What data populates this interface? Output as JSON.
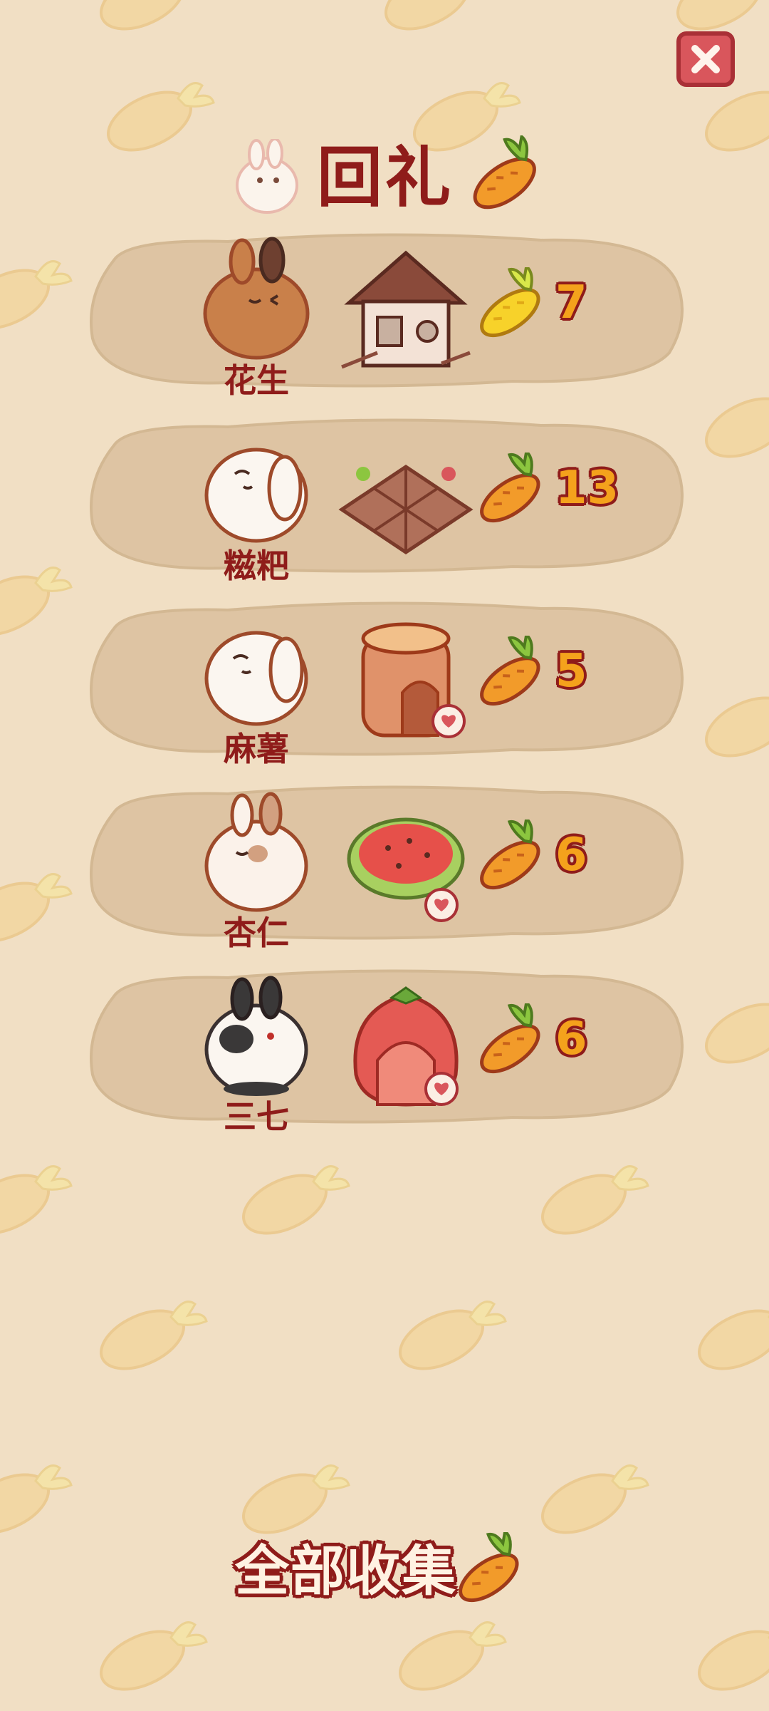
{
  "title": "回礼",
  "rewards": [
    {
      "name": "花生",
      "bunny_icon": "brown-bunny-icon",
      "item_icon": "wooden-house-icon",
      "reward_icon": "golden-carrot-icon",
      "count": "7"
    },
    {
      "name": "糍粑",
      "bunny_icon": "white-lop-bunny-icon",
      "item_icon": "garden-plot-icon",
      "reward_icon": "carrot-icon",
      "count": "13"
    },
    {
      "name": "麻薯",
      "bunny_icon": "white-lop-bunny-icon",
      "item_icon": "tree-stump-house-icon",
      "reward_icon": "carrot-icon",
      "count": "5"
    },
    {
      "name": "杏仁",
      "bunny_icon": "cream-bunny-icon",
      "item_icon": "watermelon-cushion-icon",
      "reward_icon": "carrot-icon",
      "count": "6"
    },
    {
      "name": "三七",
      "bunny_icon": "black-white-bunny-icon",
      "item_icon": "strawberry-house-icon",
      "reward_icon": "carrot-icon",
      "count": "6"
    }
  ],
  "collect_all_label": "全部收集",
  "colors": {
    "title": "#8f1c1a",
    "count": "#f4a21c",
    "close": "#d9565c",
    "background": "#f1dfc4"
  }
}
